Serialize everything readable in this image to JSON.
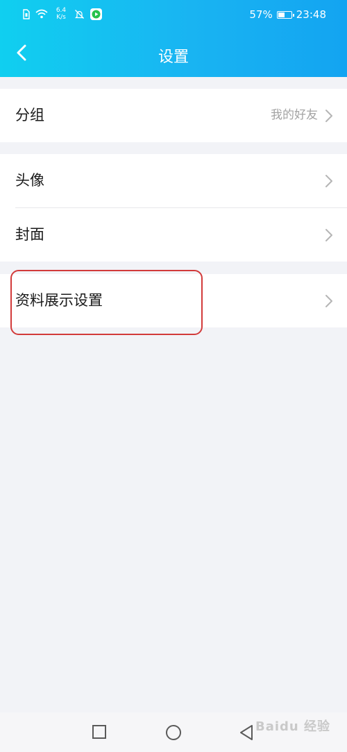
{
  "status_bar": {
    "net_speed_value": "6.4",
    "net_speed_unit": "K/s",
    "battery_percent": "57%",
    "battery_level": 0.57,
    "time": "23:48",
    "icons": [
      "sim-icon",
      "wifi-icon",
      "mute-icon",
      "app-notification-icon",
      "battery-icon"
    ]
  },
  "header": {
    "title": "设置",
    "back_icon": "chevron-left-icon"
  },
  "settings": {
    "group": {
      "label": "分组",
      "value": "我的好友"
    },
    "avatar": {
      "label": "头像"
    },
    "cover": {
      "label": "封面"
    },
    "profile_display": {
      "label": "资料展示设置"
    }
  },
  "system_nav": {
    "buttons": [
      "recent-apps-icon",
      "home-icon",
      "back-triangle-icon"
    ]
  },
  "watermark": {
    "text": "Baidu 经验"
  },
  "colors": {
    "header_gradient_start": "#10cff0",
    "header_gradient_end": "#13a4f1",
    "page_background": "#f2f3f7",
    "highlight_border": "#d23a3a"
  }
}
